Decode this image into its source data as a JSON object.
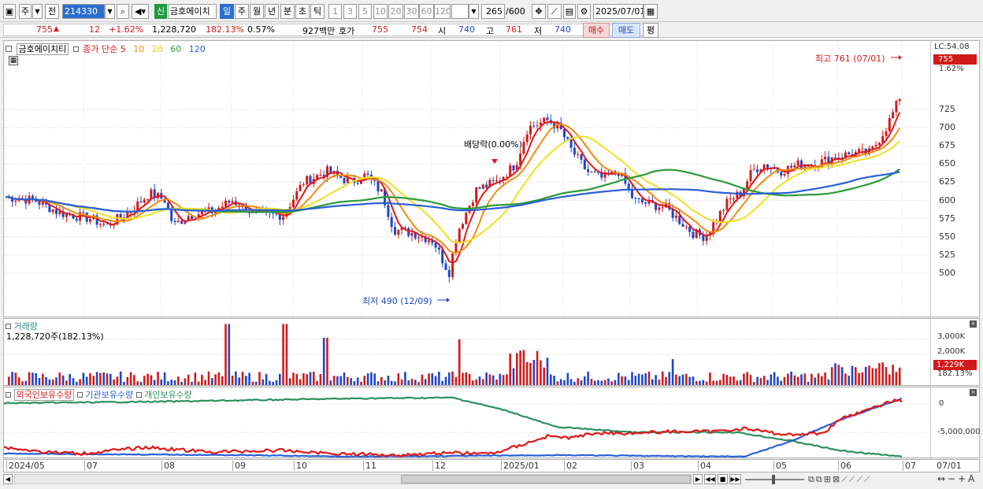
{
  "toolbar": {
    "period_main": "주",
    "type_label": "전",
    "code": "214330",
    "stock_name": "금호에이치",
    "badge_new": "신",
    "periods": [
      "일",
      "주",
      "월",
      "년",
      "분",
      "초",
      "틱"
    ],
    "intervals": [
      "1",
      "3",
      "5",
      "10",
      "20",
      "30",
      "60",
      "120"
    ],
    "count": "265",
    "count_total": "/600",
    "date": "2025/07/01"
  },
  "quote": {
    "price": "755",
    "change_arrow": "▲",
    "change": "12",
    "change_pct": "+1.62%",
    "volume": "1,228,720",
    "vol_ratio": "182.13%",
    "turnover": "0.57%",
    "amount": "927백만",
    "hoga_label": "호가",
    "ask": "755",
    "bid": "754",
    "open_label": "시",
    "open": "740",
    "high_label": "고",
    "high": "761",
    "low_label": "저",
    "low": "740",
    "buy": "매수",
    "sell": "매도",
    "avg": "평"
  },
  "price_panel": {
    "name": "금호에이치티",
    "ma_label": "종가 단순",
    "ma_periods": [
      "5",
      "10",
      "20",
      "60",
      "120"
    ],
    "ma_colors": [
      "#e01818",
      "#f08c10",
      "#f0e020",
      "#2a9a3a",
      "#2a5fd8"
    ],
    "high_annotation": "최고 761 (07/01)",
    "low_annotation": "최저 490 (12/09)",
    "dividend_annotation": "배당락(0.00%)",
    "right_top": "LC:54.08",
    "price_tag": "755",
    "pct_tag": "1.62%",
    "y_ticks": [
      "725",
      "700",
      "675",
      "650",
      "625",
      "600",
      "575",
      "550",
      "525",
      "500"
    ]
  },
  "volume_panel": {
    "title": "거래량",
    "value": "1,228,720주(182.13%)",
    "y_ticks": [
      "3,000K",
      "2,000K"
    ],
    "tag": "1,229K",
    "tag_pct": "182.13%"
  },
  "holdings_panel": {
    "series": [
      "외국인보유수량",
      "기관보유수량",
      "개인보유수량"
    ],
    "colors": [
      "#e01818",
      "#2a5fd8",
      "#2a9060"
    ],
    "y_ticks": [
      "0",
      "-5,000,000"
    ]
  },
  "x_axis": {
    "labels": [
      "2024/05",
      "07",
      "08",
      "09",
      "10",
      "11",
      "12",
      "2025/01",
      "02",
      "03",
      "04",
      "05",
      "06",
      "07"
    ],
    "right_label": "07/01"
  }
}
